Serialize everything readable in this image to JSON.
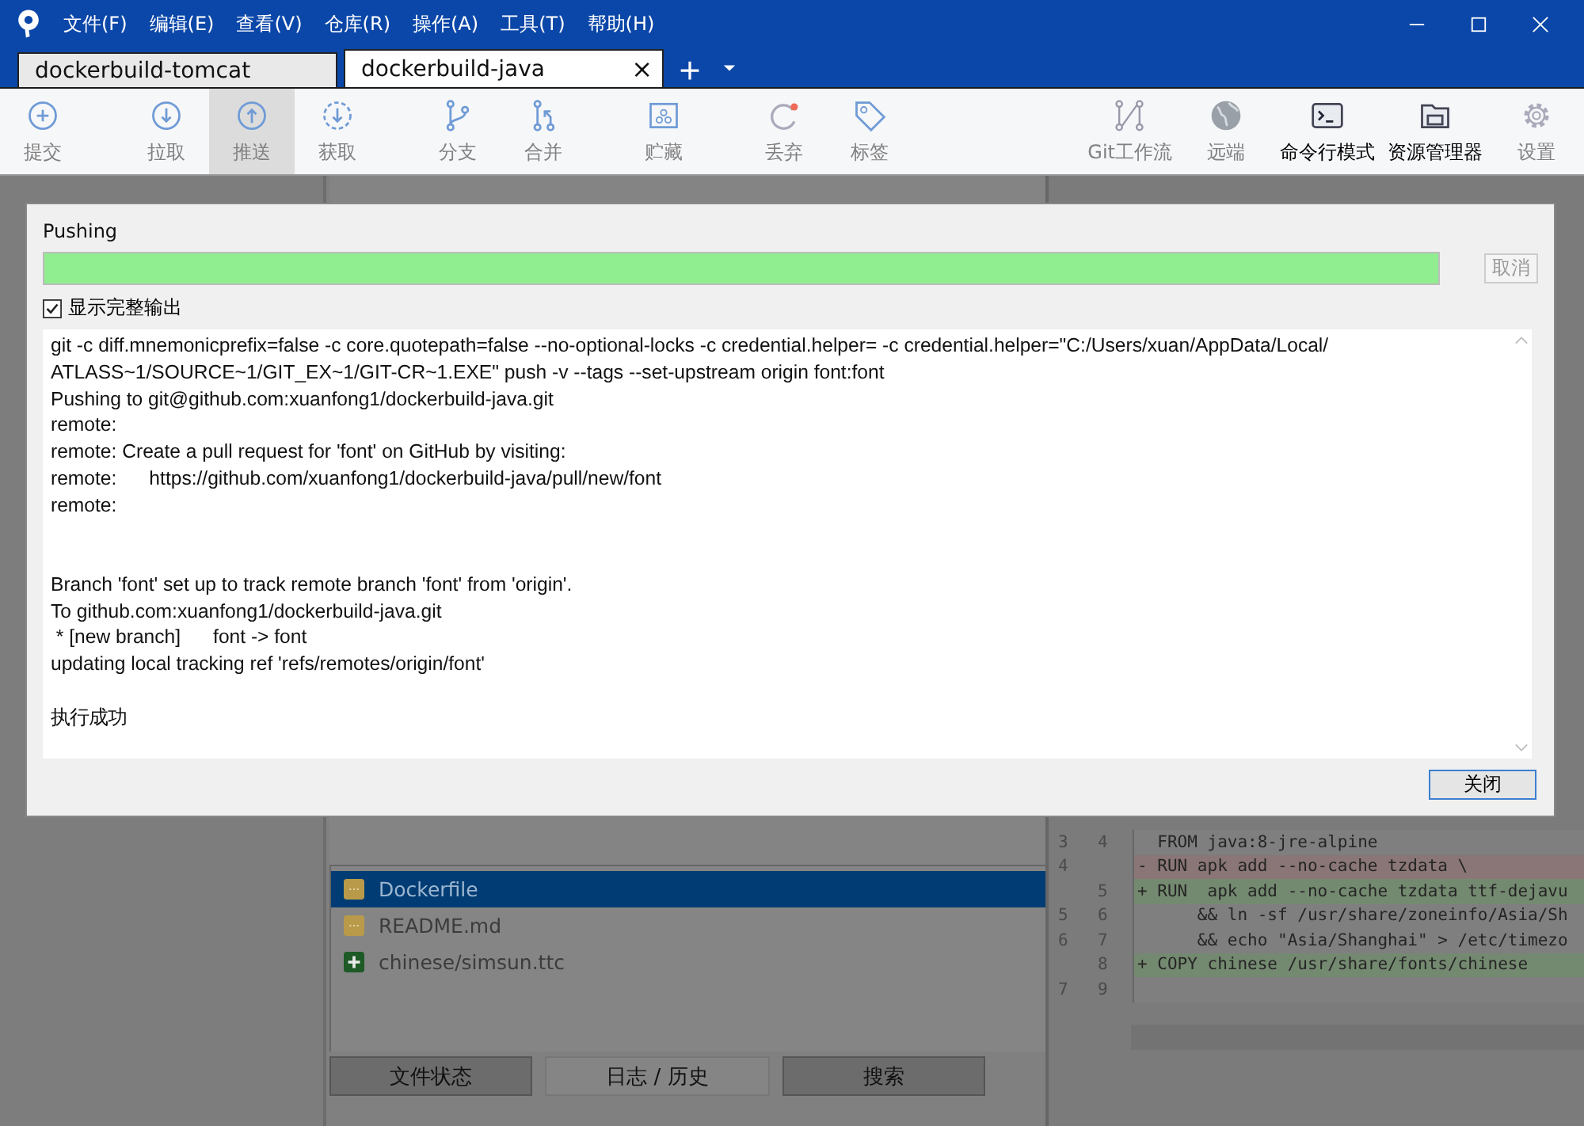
{
  "menu": [
    "文件(F)",
    "编辑(E)",
    "查看(V)",
    "仓库(R)",
    "操作(A)",
    "工具(T)",
    "帮助(H)"
  ],
  "tabs": [
    {
      "label": "dockerbuild-tomcat",
      "selected": false
    },
    {
      "label": "dockerbuild-java",
      "selected": true,
      "close": "×"
    }
  ],
  "toolbar": {
    "left_groups": [
      [
        {
          "label": "提交",
          "disabled": true,
          "selected": false
        }
      ],
      [
        {
          "label": "拉取",
          "disabled": true,
          "selected": false
        },
        {
          "label": "推送",
          "disabled": true,
          "selected": true
        },
        {
          "label": "获取",
          "disabled": true,
          "selected": false
        }
      ],
      [
        {
          "label": "分支",
          "disabled": true,
          "selected": false
        },
        {
          "label": "合并",
          "disabled": true,
          "selected": false
        }
      ],
      [
        {
          "label": "贮藏",
          "disabled": true,
          "selected": false
        }
      ],
      [
        {
          "label": "丢弃",
          "disabled": true,
          "selected": false
        },
        {
          "label": "标签",
          "disabled": true,
          "selected": false
        }
      ]
    ],
    "right": [
      {
        "label": "Git工作流",
        "disabled": true,
        "selected": false
      },
      {
        "label": "远端",
        "disabled": true,
        "selected": false
      },
      {
        "label": "命令行模式",
        "disabled": false,
        "selected": false
      },
      {
        "label": "资源管理器",
        "disabled": false,
        "selected": false
      },
      {
        "label": "设置",
        "disabled": true,
        "selected": false
      }
    ]
  },
  "files": [
    {
      "name": "Dockerfile",
      "kind": "modified",
      "selected": true
    },
    {
      "name": "README.md",
      "kind": "modified",
      "selected": false
    },
    {
      "name": "chinese/simsun.ttc",
      "kind": "added",
      "selected": false
    }
  ],
  "bottom_tabs": [
    {
      "label": "文件状态",
      "selected": false
    },
    {
      "label": "日志 / 历史",
      "selected": true
    },
    {
      "label": "搜索",
      "selected": false
    }
  ],
  "diff": [
    {
      "old": "3",
      "new": "4",
      "kind": "context",
      "text": "  FROM java:8-jre-alpine"
    },
    {
      "old": "4",
      "kind": "removed",
      "text": "- RUN apk add --no-cache tzdata \\"
    },
    {
      "new": "5",
      "kind": "added",
      "text": "+ RUN  apk add --no-cache tzdata ttf-dejavu"
    },
    {
      "old": "5",
      "new": "6",
      "kind": "context",
      "text": "      && ln -sf /usr/share/zoneinfo/Asia/Sh"
    },
    {
      "old": "6",
      "new": "7",
      "kind": "context",
      "text": "      && echo \"Asia/Shanghai\" > /etc/timezo"
    },
    {
      "new": "8",
      "kind": "added",
      "text": "+ COPY chinese /usr/share/fonts/chinese"
    },
    {
      "old": "7",
      "new": "9",
      "kind": "context"
    }
  ],
  "dialog": {
    "title": "Pushing",
    "progress": {
      "level": 1.0
    },
    "cancel": {
      "label": "取消",
      "disabled": true
    },
    "full_output": {
      "label": "显示完整输出",
      "checked": true
    },
    "output": "git -c diff.mnemonicprefix=false -c core.quotepath=false --no-optional-locks -c credential.helper= -c credential.helper=\"C:/Users/xuan/AppData/Local/\nATLASS~1/SOURCE~1/GIT_EX~1/GIT-CR~1.EXE\" push -v --tags --set-upstream origin font:font\nPushing to git@github.com:xuanfong1/dockerbuild-java.git\nremote:\nremote: Create a pull request for 'font' on GitHub by visiting:\nremote:      https://github.com/xuanfong1/dockerbuild-java/pull/new/font\nremote:\n\n\nBranch 'font' set up to track remote branch 'font' from 'origin'.\nTo github.com:xuanfong1/dockerbuild-java.git\n * [new branch]      font -> font\nupdating local tracking ref 'refs/remotes/origin/font'\n\n执行成功",
    "close": "关闭"
  }
}
